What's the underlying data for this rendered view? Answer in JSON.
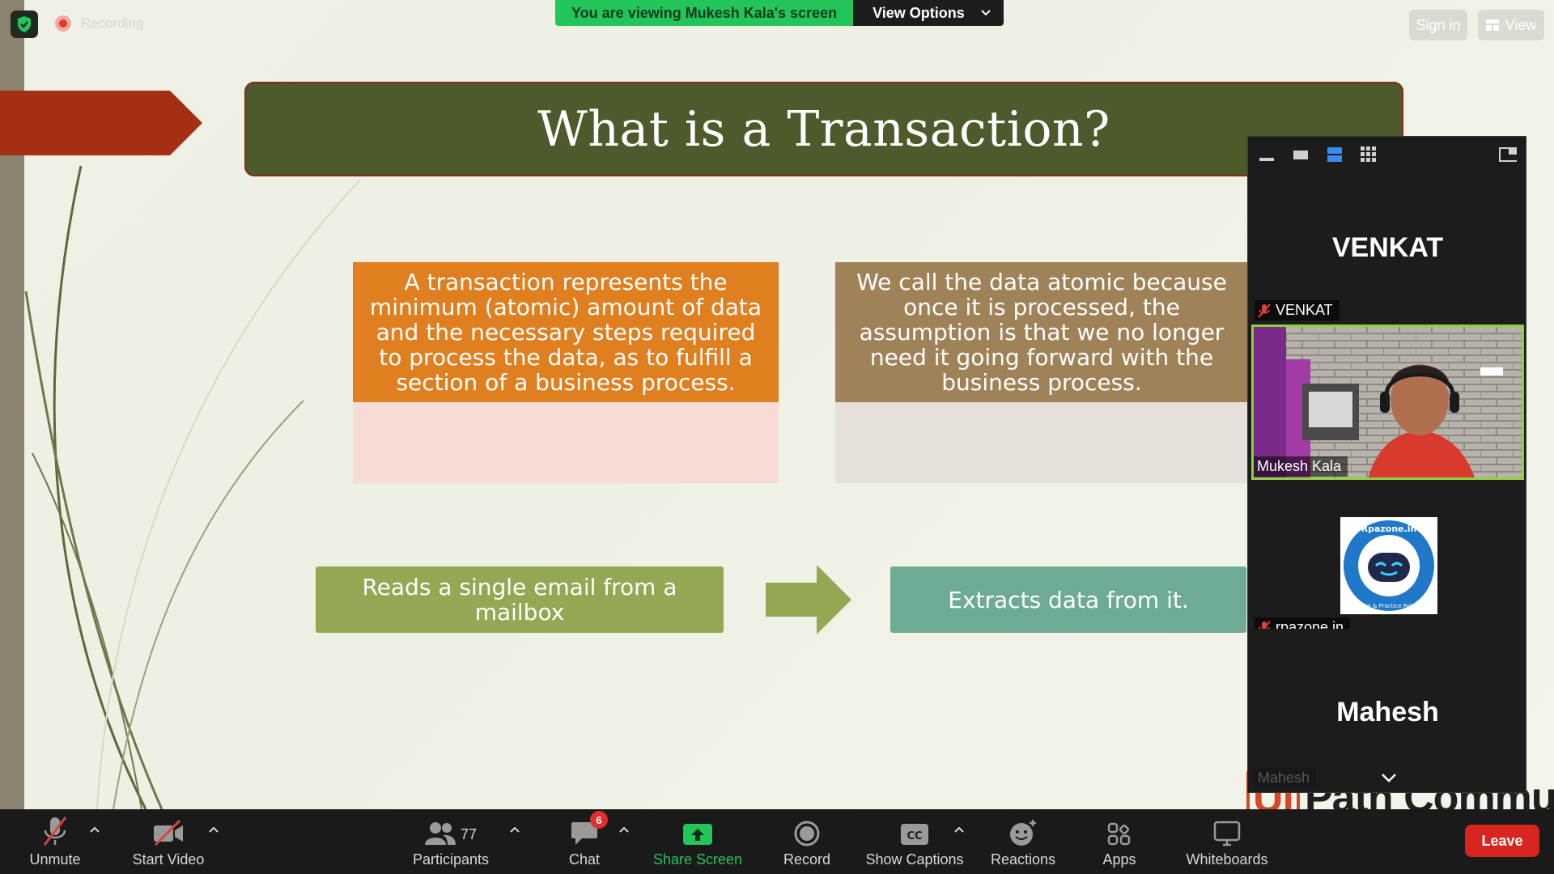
{
  "slide": {
    "title": "What is a Transaction?",
    "box_left": "A transaction represents the minimum (atomic) amount of data and the necessary steps required to process the data, as to fulfill a section of a business process.",
    "box_right": "We call the data atomic because once it is processed, the assumption is that we no longer need it going forward with the business process.",
    "flow_left": "Reads a single email from a mailbox",
    "flow_right": "Extracts data from it.",
    "watermark_ui": "Ui",
    "watermark_text": "Path Community"
  },
  "top": {
    "recording_label": "Recording",
    "viewing_text": "You are viewing Mukesh Kala's screen",
    "view_options": "View Options",
    "sign_in": "Sign in",
    "view": "View"
  },
  "panel": {
    "tiles": [
      {
        "big_name": "VENKAT",
        "label": "VENKAT"
      },
      {
        "label": "Mukesh Kala"
      },
      {
        "label": "rpazone.in",
        "logo_text": "Rpazone.in",
        "logo_sub": "Learn & Practice Robots"
      },
      {
        "big_name": "Mahesh",
        "label": "Mahesh"
      }
    ]
  },
  "toolbar": {
    "unmute": "Unmute",
    "start_video": "Start Video",
    "participants": "Participants",
    "participants_count": "77",
    "chat": "Chat",
    "chat_badge": "6",
    "share_screen": "Share Screen",
    "record": "Record",
    "show_captions": "Show Captions",
    "captions_icon": "CC",
    "reactions": "Reactions",
    "apps": "Apps",
    "whiteboards": "Whiteboards",
    "leave": "Leave"
  },
  "colors": {
    "title_banner": "#4d5a2c",
    "orange_box": "#e07f1f",
    "brown_box": "#a08259",
    "green_flow": "#94a853",
    "teal_flow": "#6eab94",
    "share_green": "#23c55a",
    "leave_red": "#d8251f"
  }
}
